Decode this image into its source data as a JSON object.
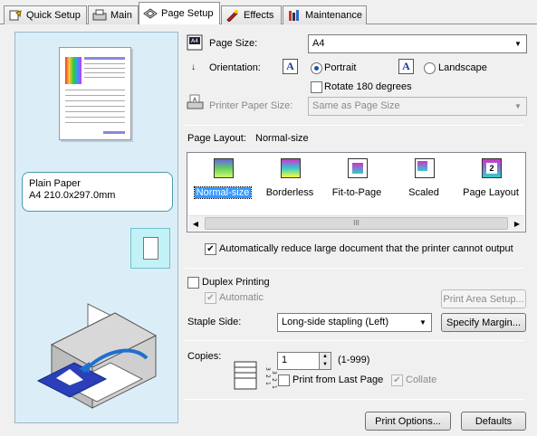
{
  "tabs": [
    {
      "label": "Quick Setup",
      "icon": "quick-setup-icon"
    },
    {
      "label": "Main",
      "icon": "main-icon"
    },
    {
      "label": "Page Setup",
      "icon": "page-setup-icon",
      "active": true
    },
    {
      "label": "Effects",
      "icon": "effects-icon"
    },
    {
      "label": "Maintenance",
      "icon": "maintenance-icon"
    }
  ],
  "preview": {
    "paper_type": "Plain Paper",
    "paper_size": "A4 210.0x297.0mm"
  },
  "page_size": {
    "label": "Page Size:",
    "value": "A4"
  },
  "orientation": {
    "label": "Orientation:",
    "portrait": "Portrait",
    "landscape": "Landscape",
    "selected": "Portrait",
    "icon_glyph": "A",
    "rotate_180": "Rotate 180 degrees"
  },
  "printer_paper_size": {
    "label": "Printer Paper Size:",
    "value": "Same as Page Size"
  },
  "page_layout": {
    "label": "Page Layout:",
    "current": "Normal-size",
    "items": [
      "Normal-size",
      "Borderless",
      "Fit-to-Page",
      "Scaled",
      "Page Layout"
    ],
    "scroll_thumb": "III"
  },
  "auto_reduce": {
    "label": "Automatically reduce large document that the printer cannot output",
    "checked": true
  },
  "duplex": {
    "label": "Duplex Printing",
    "automatic": "Automatic",
    "print_area_button": "Print Area Setup...",
    "staple_label": "Staple Side:",
    "staple_value": "Long-side stapling (Left)",
    "specify_margin_button": "Specify Margin..."
  },
  "copies": {
    "label": "Copies:",
    "value": "1",
    "range": "(1-999)",
    "print_from_last": "Print from Last Page",
    "collate": "Collate"
  },
  "footer": {
    "print_options_button": "Print Options...",
    "defaults_button": "Defaults"
  },
  "colors": {
    "accent": "#3399ff",
    "panel_bg": "#dbeef8",
    "orient_box": "#c2f2f6"
  }
}
